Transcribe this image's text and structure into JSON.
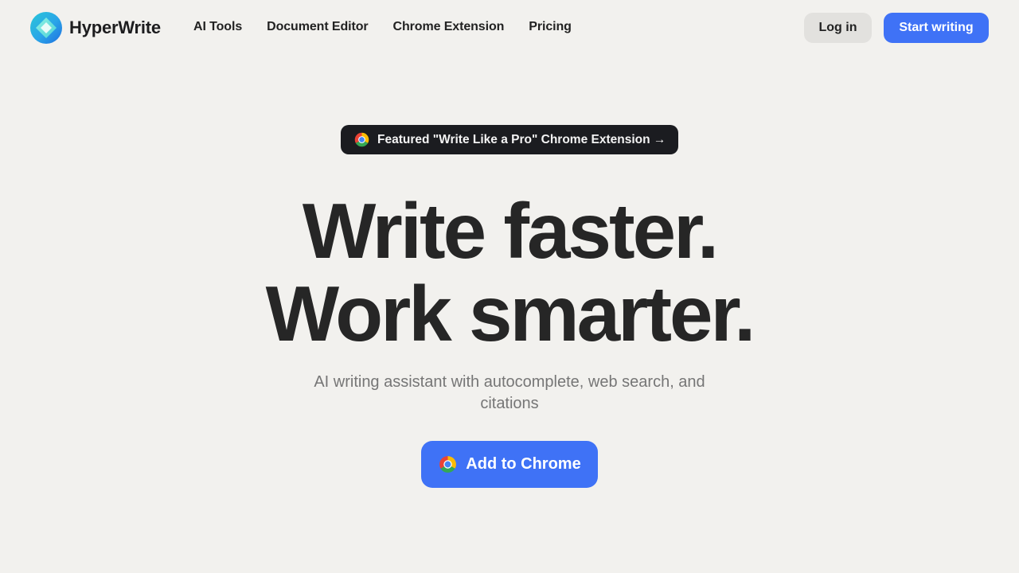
{
  "header": {
    "brand_name": "HyperWrite",
    "nav": [
      "AI Tools",
      "Document Editor",
      "Chrome Extension",
      "Pricing"
    ],
    "login_label": "Log in",
    "start_label": "Start writing"
  },
  "hero": {
    "badge_text": "Featured \"Write Like a Pro\" Chrome Extension →",
    "headline_line1": "Write faster.",
    "headline_line2": "Work smarter.",
    "subtitle": "AI writing assistant with autocomplete, web search, and citations",
    "cta_label": "Add to Chrome"
  },
  "icons": {
    "brand": "hyperwrite-logo-icon",
    "badge": "chrome-icon",
    "cta": "chrome-icon"
  },
  "colors": {
    "background": "#f2f1ee",
    "accent": "#3f72f6",
    "badge_bg": "#1b1c20",
    "text": "#262626",
    "subtitle": "#767676"
  }
}
